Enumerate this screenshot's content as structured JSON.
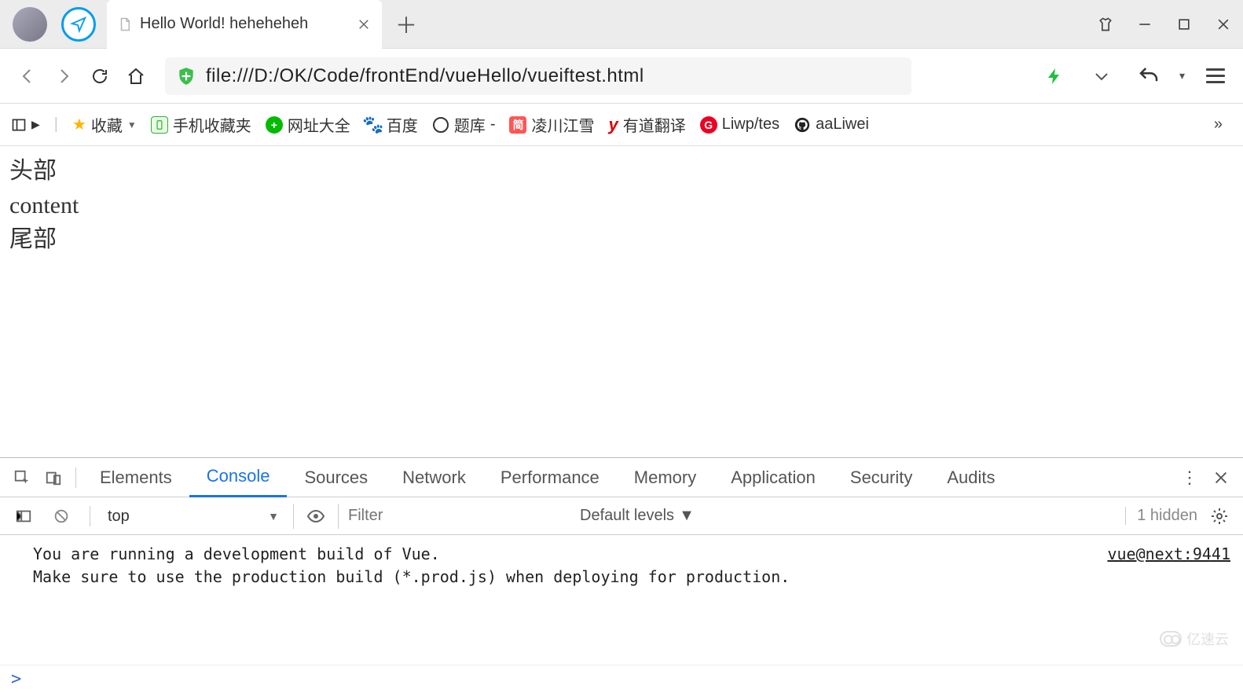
{
  "titlebar": {
    "tab_title": "Hello World! heheheheh"
  },
  "addressbar": {
    "url": "file:///D:/OK/Code/frontEnd/vueHello/vueiftest.html"
  },
  "bookmarks": {
    "items": [
      {
        "label": "收藏"
      },
      {
        "label": "手机收藏夹"
      },
      {
        "label": "网址大全"
      },
      {
        "label": "百度"
      },
      {
        "label": "题库"
      },
      {
        "label": "凌川江雪"
      },
      {
        "label": "有道翻译"
      },
      {
        "label": "Liwp/tes"
      },
      {
        "label": "aaLiwei"
      }
    ],
    "dash": "-"
  },
  "page": {
    "line1": "头部",
    "line2": "content",
    "line3": "尾部"
  },
  "devtools": {
    "tabs": [
      "Elements",
      "Console",
      "Sources",
      "Network",
      "Performance",
      "Memory",
      "Application",
      "Security",
      "Audits"
    ],
    "active_tab": "Console",
    "context": "top",
    "filter_placeholder": "Filter",
    "levels_label": "Default levels",
    "hidden_label": "1 hidden",
    "message": "You are running a development build of Vue.\nMake sure to use the production build (*.prod.js) when deploying for production.",
    "source": "vue@next:9441",
    "prompt": ">"
  },
  "watermark": "亿速云"
}
